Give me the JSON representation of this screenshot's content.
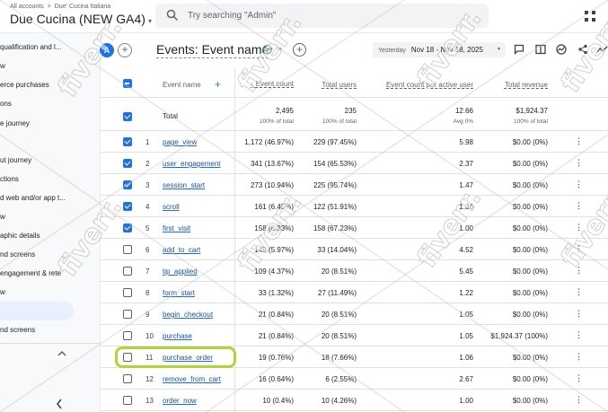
{
  "header": {
    "breadcrumb_parent": "All accounts",
    "breadcrumb_child": "Due' Cucina Italiana",
    "property_name": "Due Cucina (NEW GA4)",
    "search_placeholder": "Try searching \"Admin\""
  },
  "sidebar": {
    "items": [
      "qualification and l...",
      "w",
      "erce purchases",
      "ons",
      "e journey",
      "ut journey",
      "ctions",
      "d web and/or app t...",
      "w",
      "aphic details",
      "nd screens",
      "engagement & rete",
      "w",
      "",
      "nd screens"
    ]
  },
  "report": {
    "avatar_letter": "A",
    "title": "Events: Event name",
    "date_label": "Yesterday",
    "date_value": "Nov 18 - Nov 18, 2025"
  },
  "table": {
    "headers": {
      "event_name": "Event name",
      "event_count": "Event count",
      "total_users": "Total users",
      "per_user": "Event count per active user",
      "revenue": "Total revenue"
    },
    "total": {
      "label": "Total",
      "event_count": "2,495",
      "event_count_sub": "100% of total",
      "total_users": "235",
      "total_users_sub": "100% of total",
      "per_user": "12.66",
      "per_user_sub": "Avg 0%",
      "revenue": "$1,924.37",
      "revenue_sub": "100% of total"
    },
    "rows": [
      {
        "idx": "1",
        "name": "page_view",
        "count": "1,172 (46.97%)",
        "users": "229 (97.45%)",
        "per_user": "5.98",
        "revenue": "$0.00 (0%)",
        "checked": true
      },
      {
        "idx": "2",
        "name": "user_engagement",
        "count": "341 (13.67%)",
        "users": "154 (65.53%)",
        "per_user": "2.37",
        "revenue": "$0.00 (0%)",
        "checked": true
      },
      {
        "idx": "3",
        "name": "session_start",
        "count": "273 (10.94%)",
        "users": "225 (95.74%)",
        "per_user": "1.47",
        "revenue": "$0.00 (0%)",
        "checked": true
      },
      {
        "idx": "4",
        "name": "scroll",
        "count": "161 (6.45%)",
        "users": "122 (51.91%)",
        "per_user": "1.36",
        "revenue": "$0.00 (0%)",
        "checked": true
      },
      {
        "idx": "5",
        "name": "first_visit",
        "count": "158 (6.33%)",
        "users": "158 (67.23%)",
        "per_user": "1.00",
        "revenue": "$0.00 (0%)",
        "checked": true
      },
      {
        "idx": "6",
        "name": "add_to_cart",
        "count": "149 (5.97%)",
        "users": "33 (14.04%)",
        "per_user": "4.52",
        "revenue": "$0.00 (0%)",
        "checked": false
      },
      {
        "idx": "7",
        "name": "tip_applied",
        "count": "109 (4.37%)",
        "users": "20 (8.51%)",
        "per_user": "5.45",
        "revenue": "$0.00 (0%)",
        "checked": false
      },
      {
        "idx": "8",
        "name": "form_start",
        "count": "33 (1.32%)",
        "users": "27 (11.49%)",
        "per_user": "1.22",
        "revenue": "$0.00 (0%)",
        "checked": false
      },
      {
        "idx": "9",
        "name": "begin_checkout",
        "count": "21 (0.84%)",
        "users": "20 (8.51%)",
        "per_user": "1.05",
        "revenue": "$0.00 (0%)",
        "checked": false
      },
      {
        "idx": "10",
        "name": "purchase",
        "count": "21 (0.84%)",
        "users": "20 (8.51%)",
        "per_user": "1.05",
        "revenue": "$1,924.37 (100%)",
        "checked": false
      },
      {
        "idx": "11",
        "name": "purchase_order",
        "count": "19 (0.76%)",
        "users": "18 (7.66%)",
        "per_user": "1.06",
        "revenue": "$0.00 (0%)",
        "checked": false
      },
      {
        "idx": "12",
        "name": "remove_from_cart",
        "count": "16 (0.64%)",
        "users": "6 (2.55%)",
        "per_user": "2.67",
        "revenue": "$0.00 (0%)",
        "checked": false
      },
      {
        "idx": "13",
        "name": "order_now",
        "count": "10 (0.4%)",
        "users": "10 (4.26%)",
        "per_user": "1.00",
        "revenue": "$0.00 (0%)",
        "checked": false
      }
    ]
  },
  "colors": {
    "accent": "#1a73e8",
    "highlight": "#b5d334"
  },
  "watermark_text": "fiverr."
}
